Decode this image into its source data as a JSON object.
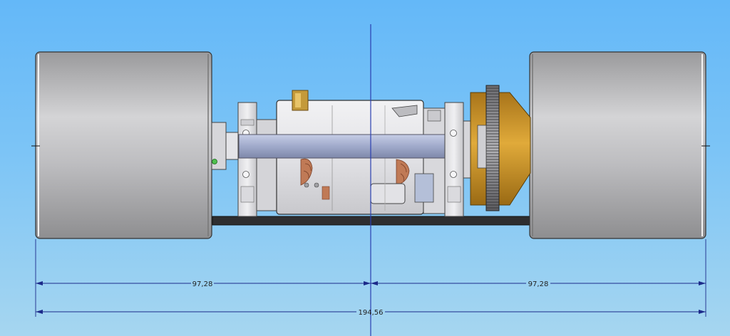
{
  "drawing": {
    "dimensions": {
      "left_half": "97,28",
      "right_half": "97,28",
      "overall": "194,56"
    },
    "colors": {
      "background_top": "#64b8f8",
      "background_bottom": "#a6d6f0",
      "dimension_line": "#1c2a8a",
      "center_line": "#2a3fb0",
      "wheel": "#a8a8aa",
      "axle": "#98a4c8",
      "brass": "#c8901e",
      "copper": "#c07a56",
      "chassis": "#2e2e30"
    }
  }
}
